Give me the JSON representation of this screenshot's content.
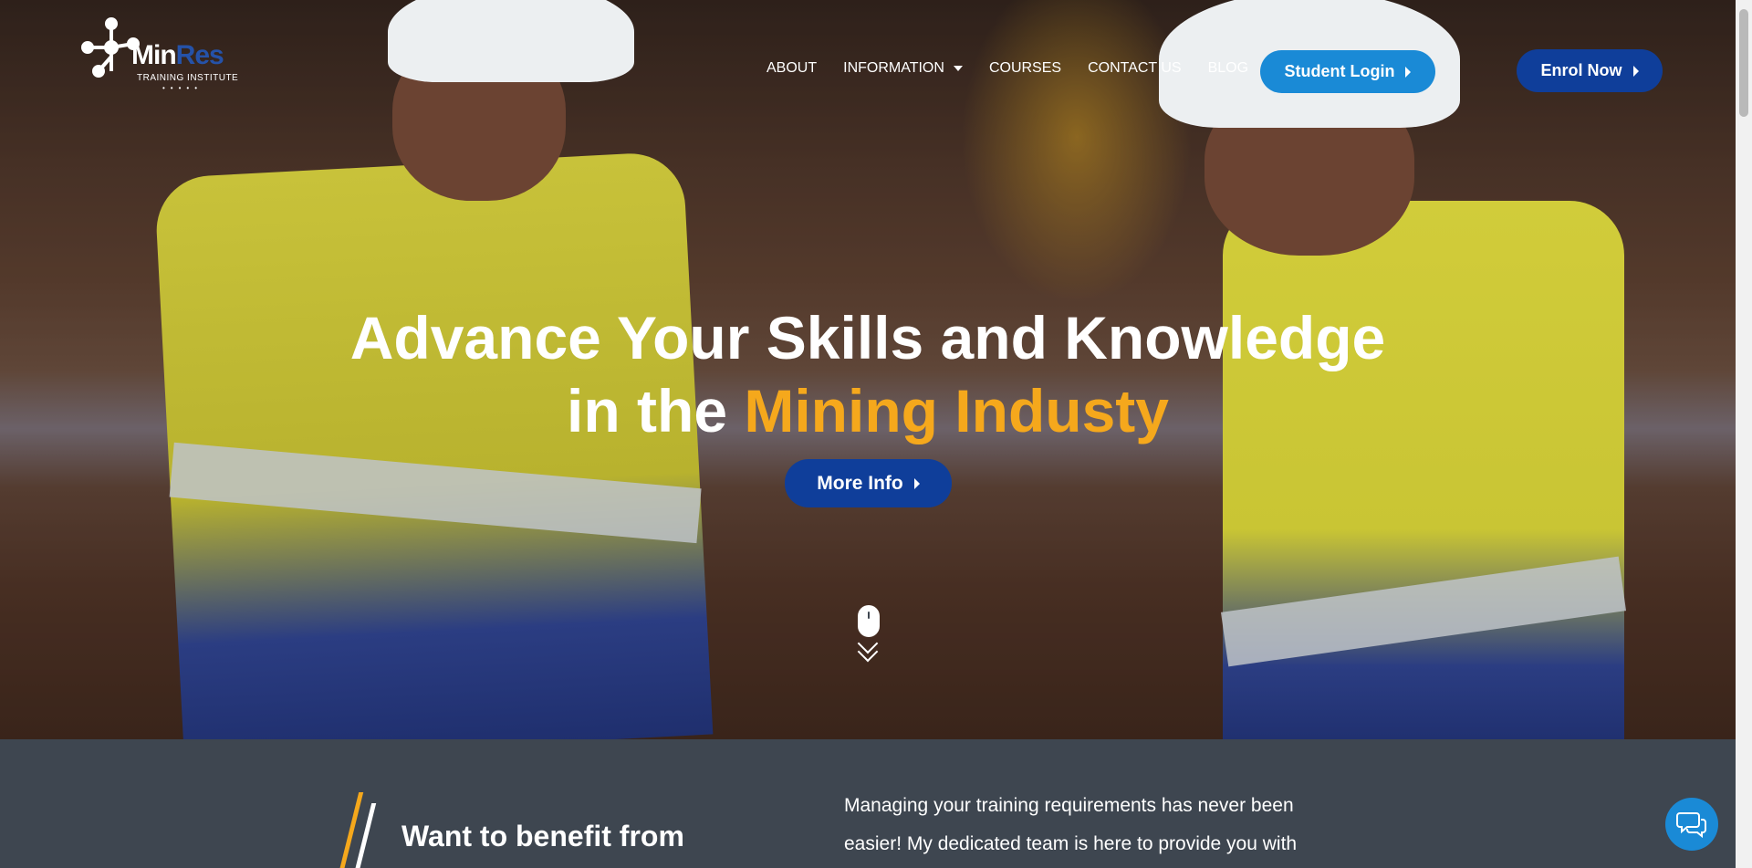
{
  "brand": {
    "name_part1": "Min",
    "name_part2": "Res",
    "subtitle": "TRAINING INSTITUTE",
    "dots": "•••••"
  },
  "nav": {
    "items": [
      {
        "label": "ABOUT"
      },
      {
        "label": "INFORMATION",
        "has_dropdown": true
      },
      {
        "label": "COURSES"
      },
      {
        "label": "CONTACT US"
      },
      {
        "label": "BLOG"
      }
    ]
  },
  "header_buttons": {
    "student_login": "Student Login",
    "enrol_now": "Enrol Now"
  },
  "hero": {
    "title_line1": "Advance Your Skills and Knowledge",
    "title_line2_prefix": "in the ",
    "title_line2_accent": "Mining Industy",
    "more_info_label": "More Info"
  },
  "section": {
    "heading": "Want to benefit from",
    "paragraph": "Managing your training requirements has never been easier! My dedicated team is here to provide you with"
  },
  "colors": {
    "accent_orange": "#f5a81c",
    "primary_blue": "#0f3e9a",
    "login_blue": "#1a8ad6",
    "section_bg": "#3e4650"
  },
  "icons": {
    "logo": "molecule-logo-icon",
    "scroll_hint": "mouse-icon",
    "scroll_chevrons": "double-chevron-down-icon",
    "chat": "chat-bubbles-icon"
  }
}
